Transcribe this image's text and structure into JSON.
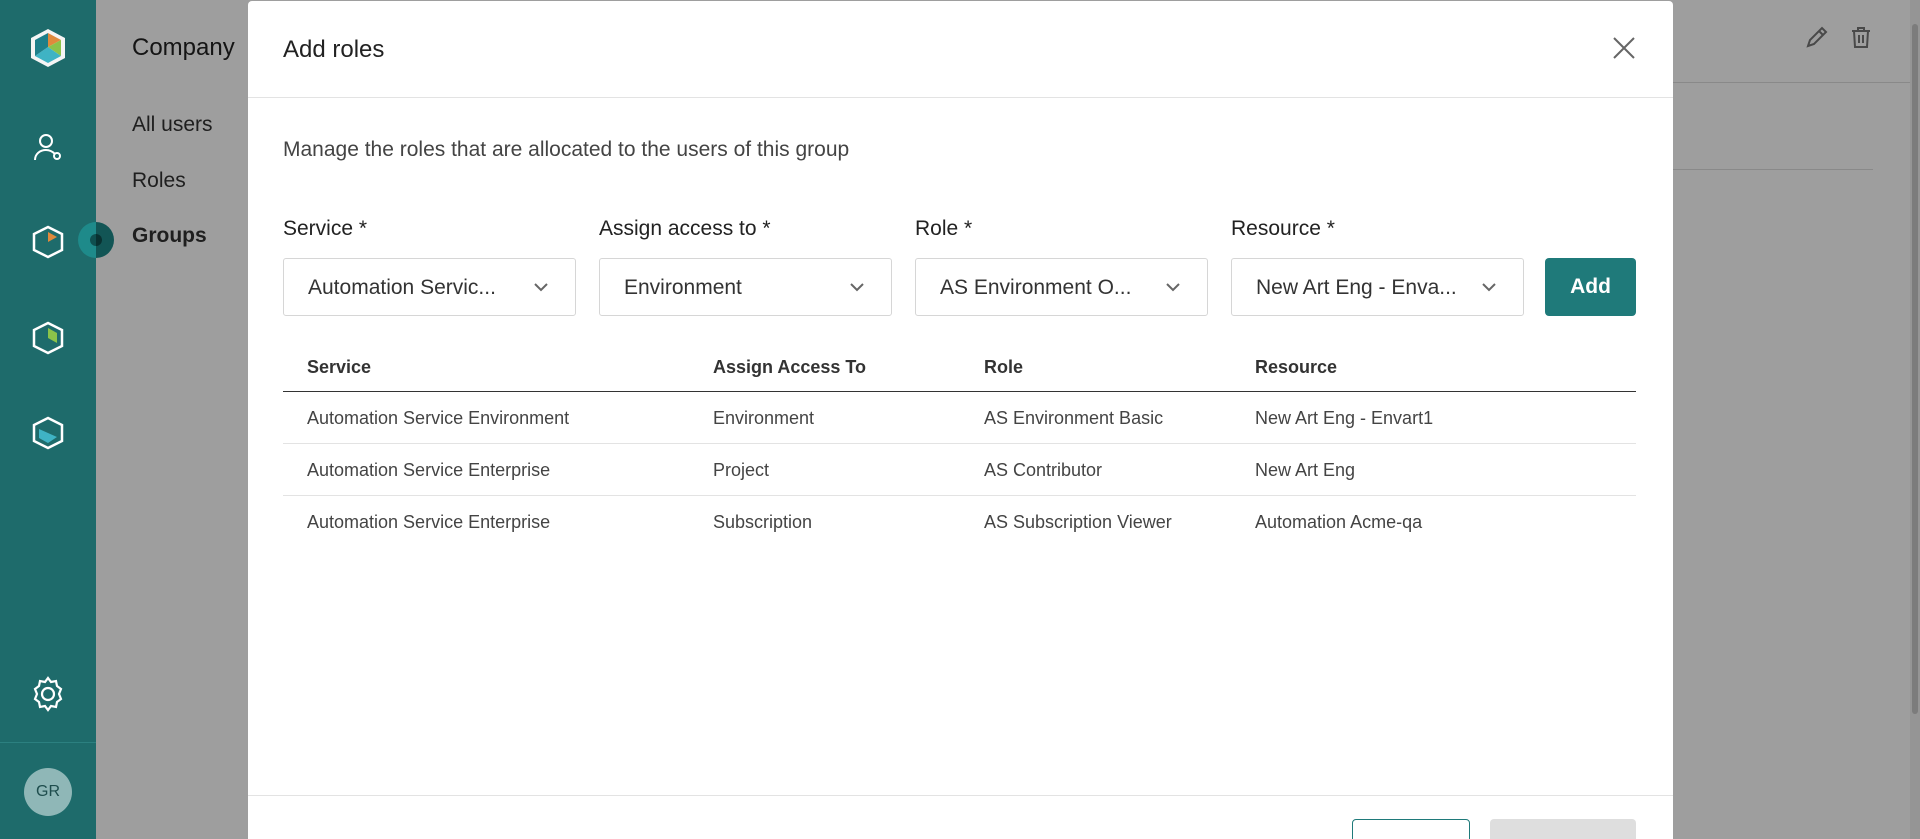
{
  "rail": {
    "user_initials": "GR"
  },
  "page": {
    "section_title": "Company",
    "nav": {
      "all_users": "All users",
      "roles": "Roles",
      "groups": "Groups"
    }
  },
  "modal": {
    "title": "Add roles",
    "description": "Manage the roles that are allocated to the users of this group",
    "fields": {
      "service": {
        "label": "Service *",
        "value": "Automation Servic..."
      },
      "assign": {
        "label": "Assign access to *",
        "value": "Environment"
      },
      "role": {
        "label": "Role *",
        "value": "AS Environment O..."
      },
      "resource": {
        "label": "Resource *",
        "value": "New Art Eng - Enva..."
      }
    },
    "add_label": "Add",
    "table": {
      "headers": [
        "Service",
        "Assign Access To",
        "Role",
        "Resource"
      ],
      "rows": [
        [
          "Automation Service Environment",
          "Environment",
          "AS Environment Basic",
          "New Art Eng - Envart1"
        ],
        [
          "Automation Service Enterprise",
          "Project",
          "AS Contributor",
          "New Art Eng"
        ],
        [
          "Automation Service Enterprise",
          "Subscription",
          "AS Subscription Viewer",
          "Automation Acme-qa"
        ]
      ]
    }
  },
  "colors": {
    "rail": "#1e6b6b",
    "accent": "#1f7a7a"
  }
}
